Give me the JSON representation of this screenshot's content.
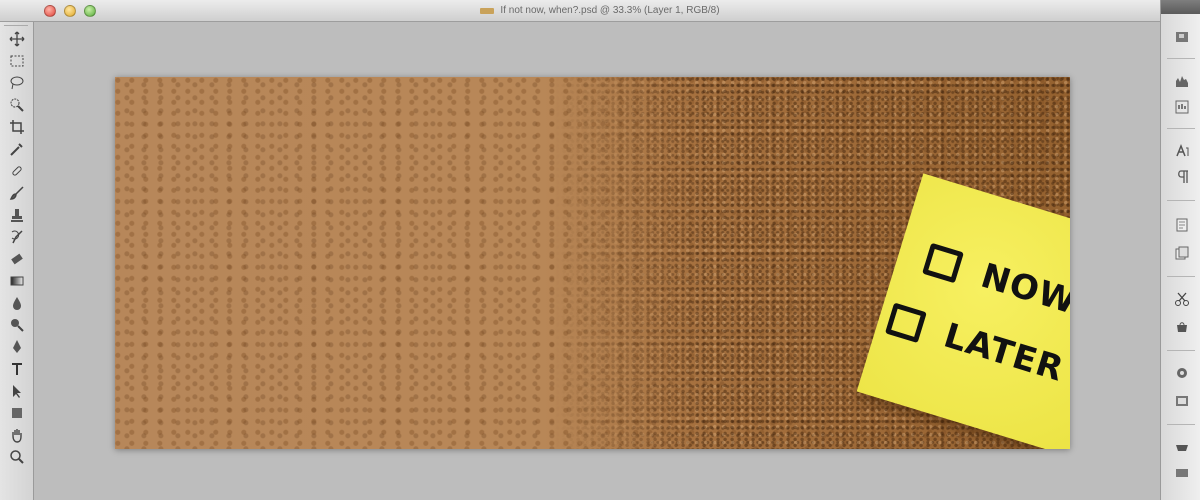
{
  "window": {
    "title": "If not now, when?.psd @ 33.3% (Layer 1, RGB/8)"
  },
  "tools_panel": {
    "icons": [
      "move-tool-icon",
      "marquee-tool-icon",
      "lasso-tool-icon",
      "quick-select-tool-icon",
      "crop-tool-icon",
      "eyedropper-tool-icon",
      "healing-brush-tool-icon",
      "brush-tool-icon",
      "clone-stamp-tool-icon",
      "history-brush-tool-icon",
      "eraser-tool-icon",
      "gradient-tool-icon",
      "blur-tool-icon",
      "dodge-tool-icon",
      "pen-tool-icon",
      "type-tool-icon",
      "path-select-tool-icon",
      "shape-tool-icon",
      "hand-tool-icon",
      "zoom-tool-icon"
    ]
  },
  "dock": {
    "icons": [
      "navigator-panel-icon",
      "histogram-panel-icon",
      "info-panel-icon",
      "character-panel-icon",
      "paragraph-panel-icon",
      "layers-panel-icon",
      "channels-panel-icon",
      "tools-presets-icon",
      "styles-panel-icon",
      "swatches-panel-icon",
      "adjustments-panel-icon",
      "masks-panel-icon"
    ]
  },
  "canvas": {
    "note": {
      "option_1": "NOW",
      "option_2": "LATER"
    },
    "colors": {
      "cork": "#b28253",
      "note": "#f2ea55",
      "ink": "#111111"
    }
  }
}
